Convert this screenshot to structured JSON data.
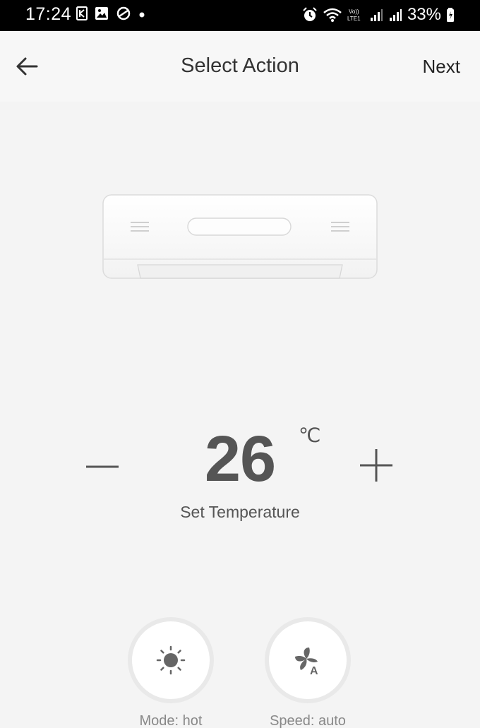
{
  "status_bar": {
    "time": "17:24",
    "battery": "33%",
    "icons_left": [
      "k-icon",
      "image-icon",
      "sync-icon",
      "dot-icon"
    ],
    "icons_right": [
      "alarm-icon",
      "wifi-icon",
      "volte-icon",
      "signal-icon",
      "signal-icon",
      "battery-icon"
    ]
  },
  "header": {
    "title": "Select Action",
    "next_label": "Next"
  },
  "temperature": {
    "value": "26",
    "unit": "℃",
    "label": "Set Temperature"
  },
  "controls": [
    {
      "label": "Mode: hot",
      "icon": "sun-icon"
    },
    {
      "label": "Speed: auto",
      "icon": "fan-auto-icon"
    }
  ]
}
